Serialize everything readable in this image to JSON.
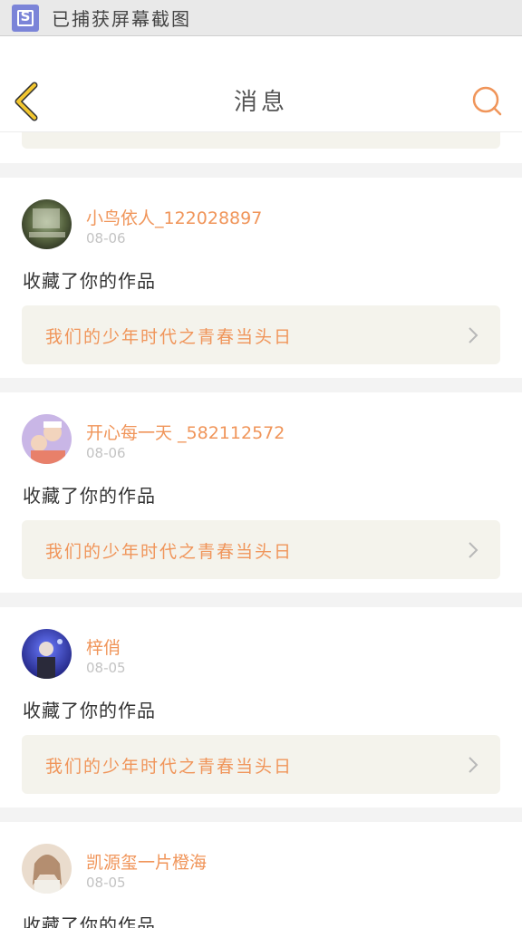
{
  "toast": {
    "text": "已捕获屏幕截图",
    "icon": "screenshot-icon",
    "icon_letter": "S",
    "icon_color": "#7b84d8"
  },
  "header": {
    "title": "消息",
    "back_icon": "chevron-left-icon",
    "search_icon": "search-icon",
    "back_color": "#f2c62f",
    "search_color": "#f0955a"
  },
  "colors": {
    "accent": "#f0955a",
    "link_bg": "#f4f3ec",
    "date": "#c3c3c3"
  },
  "messages": [
    {
      "user": "小鸟依人_122028897",
      "date": "08-06",
      "action": "收藏了你的作品",
      "work_title": "我们的少年时代之青春当头日"
    },
    {
      "user": "开心每一天 _582112572",
      "date": "08-06",
      "action": "收藏了你的作品",
      "work_title": "我们的少年时代之青春当头日"
    },
    {
      "user": "梓俏",
      "date": "08-05",
      "action": "收藏了你的作品",
      "work_title": "我们的少年时代之青春当头日"
    },
    {
      "user": "凯源玺一片橙海",
      "date": "08-05",
      "action": "收藏了你的作品"
    }
  ]
}
